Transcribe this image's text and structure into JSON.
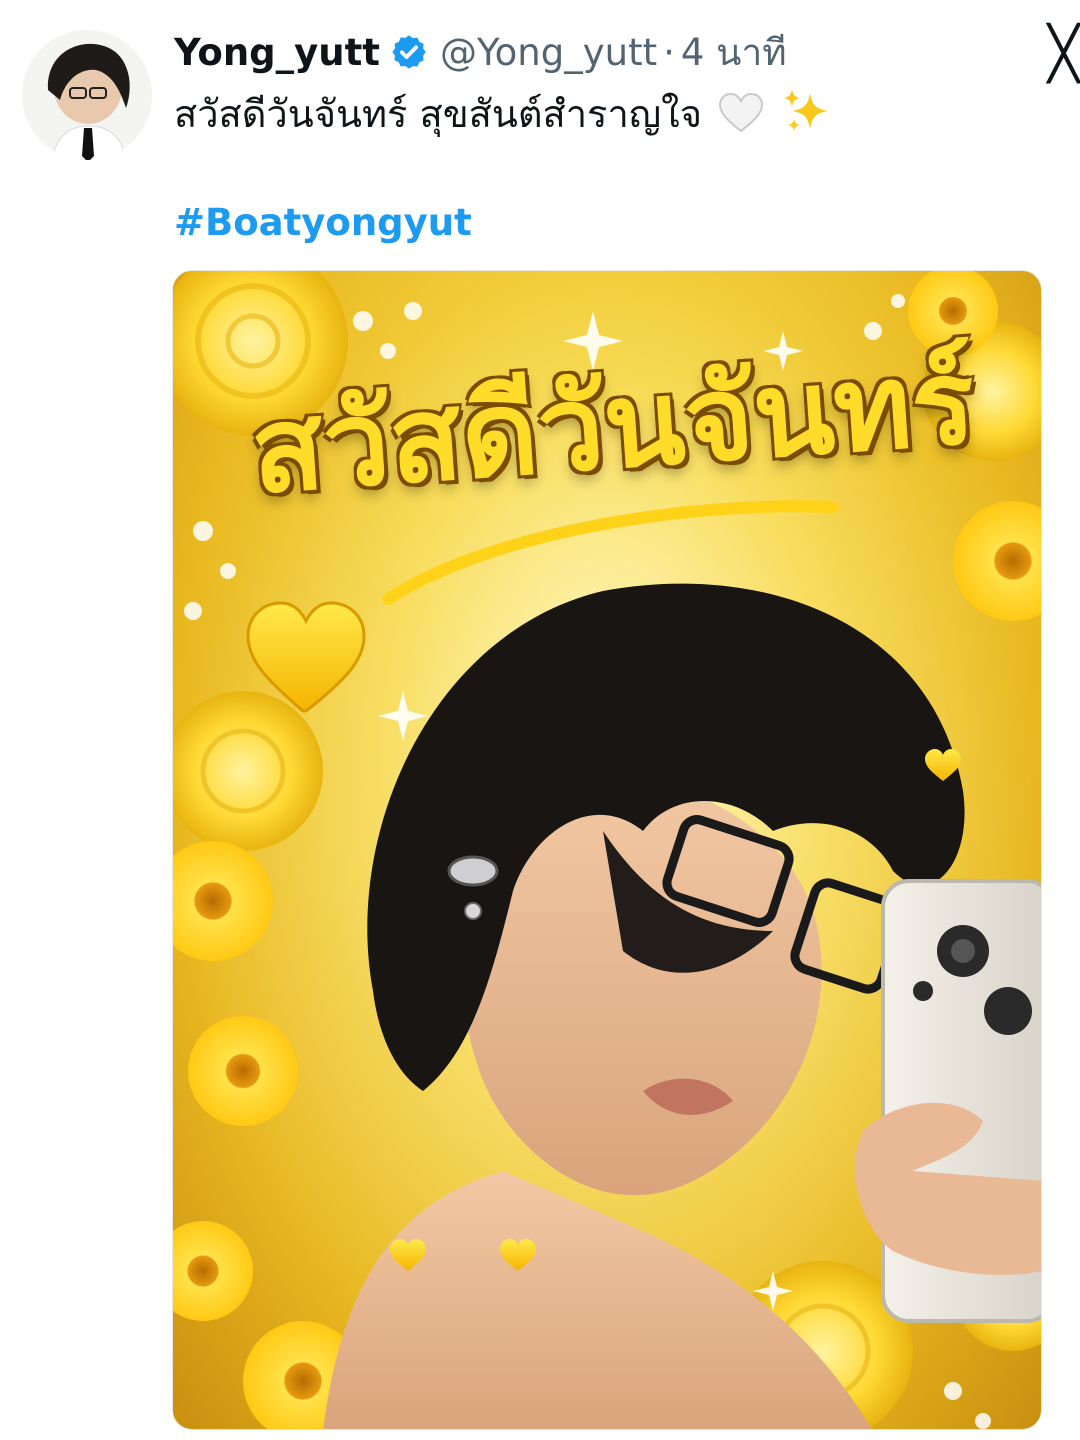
{
  "tweet": {
    "display_name": "Yong_yutt",
    "handle": "@Yong_yutt",
    "separator": "·",
    "time": "4 นาที",
    "text": "สวัสดีวันจันทร์ สุขสันต์สำราญใจ",
    "hashtag": "#Boatyongyut",
    "verified_color": "#1d9bf0"
  },
  "icons": {
    "verified": "verified-badge-icon",
    "close": "close-icon",
    "heart_emoji": "white-heart-emoji-icon",
    "sparkles_emoji": "sparkles-emoji-icon"
  },
  "media": {
    "overlay_title": "สวัสดีวันจันทร์",
    "theme_colors": [
      "#ffdc2a",
      "#f7d94a",
      "#e8b820",
      "#c98f10"
    ]
  },
  "close_glyph": "╳"
}
